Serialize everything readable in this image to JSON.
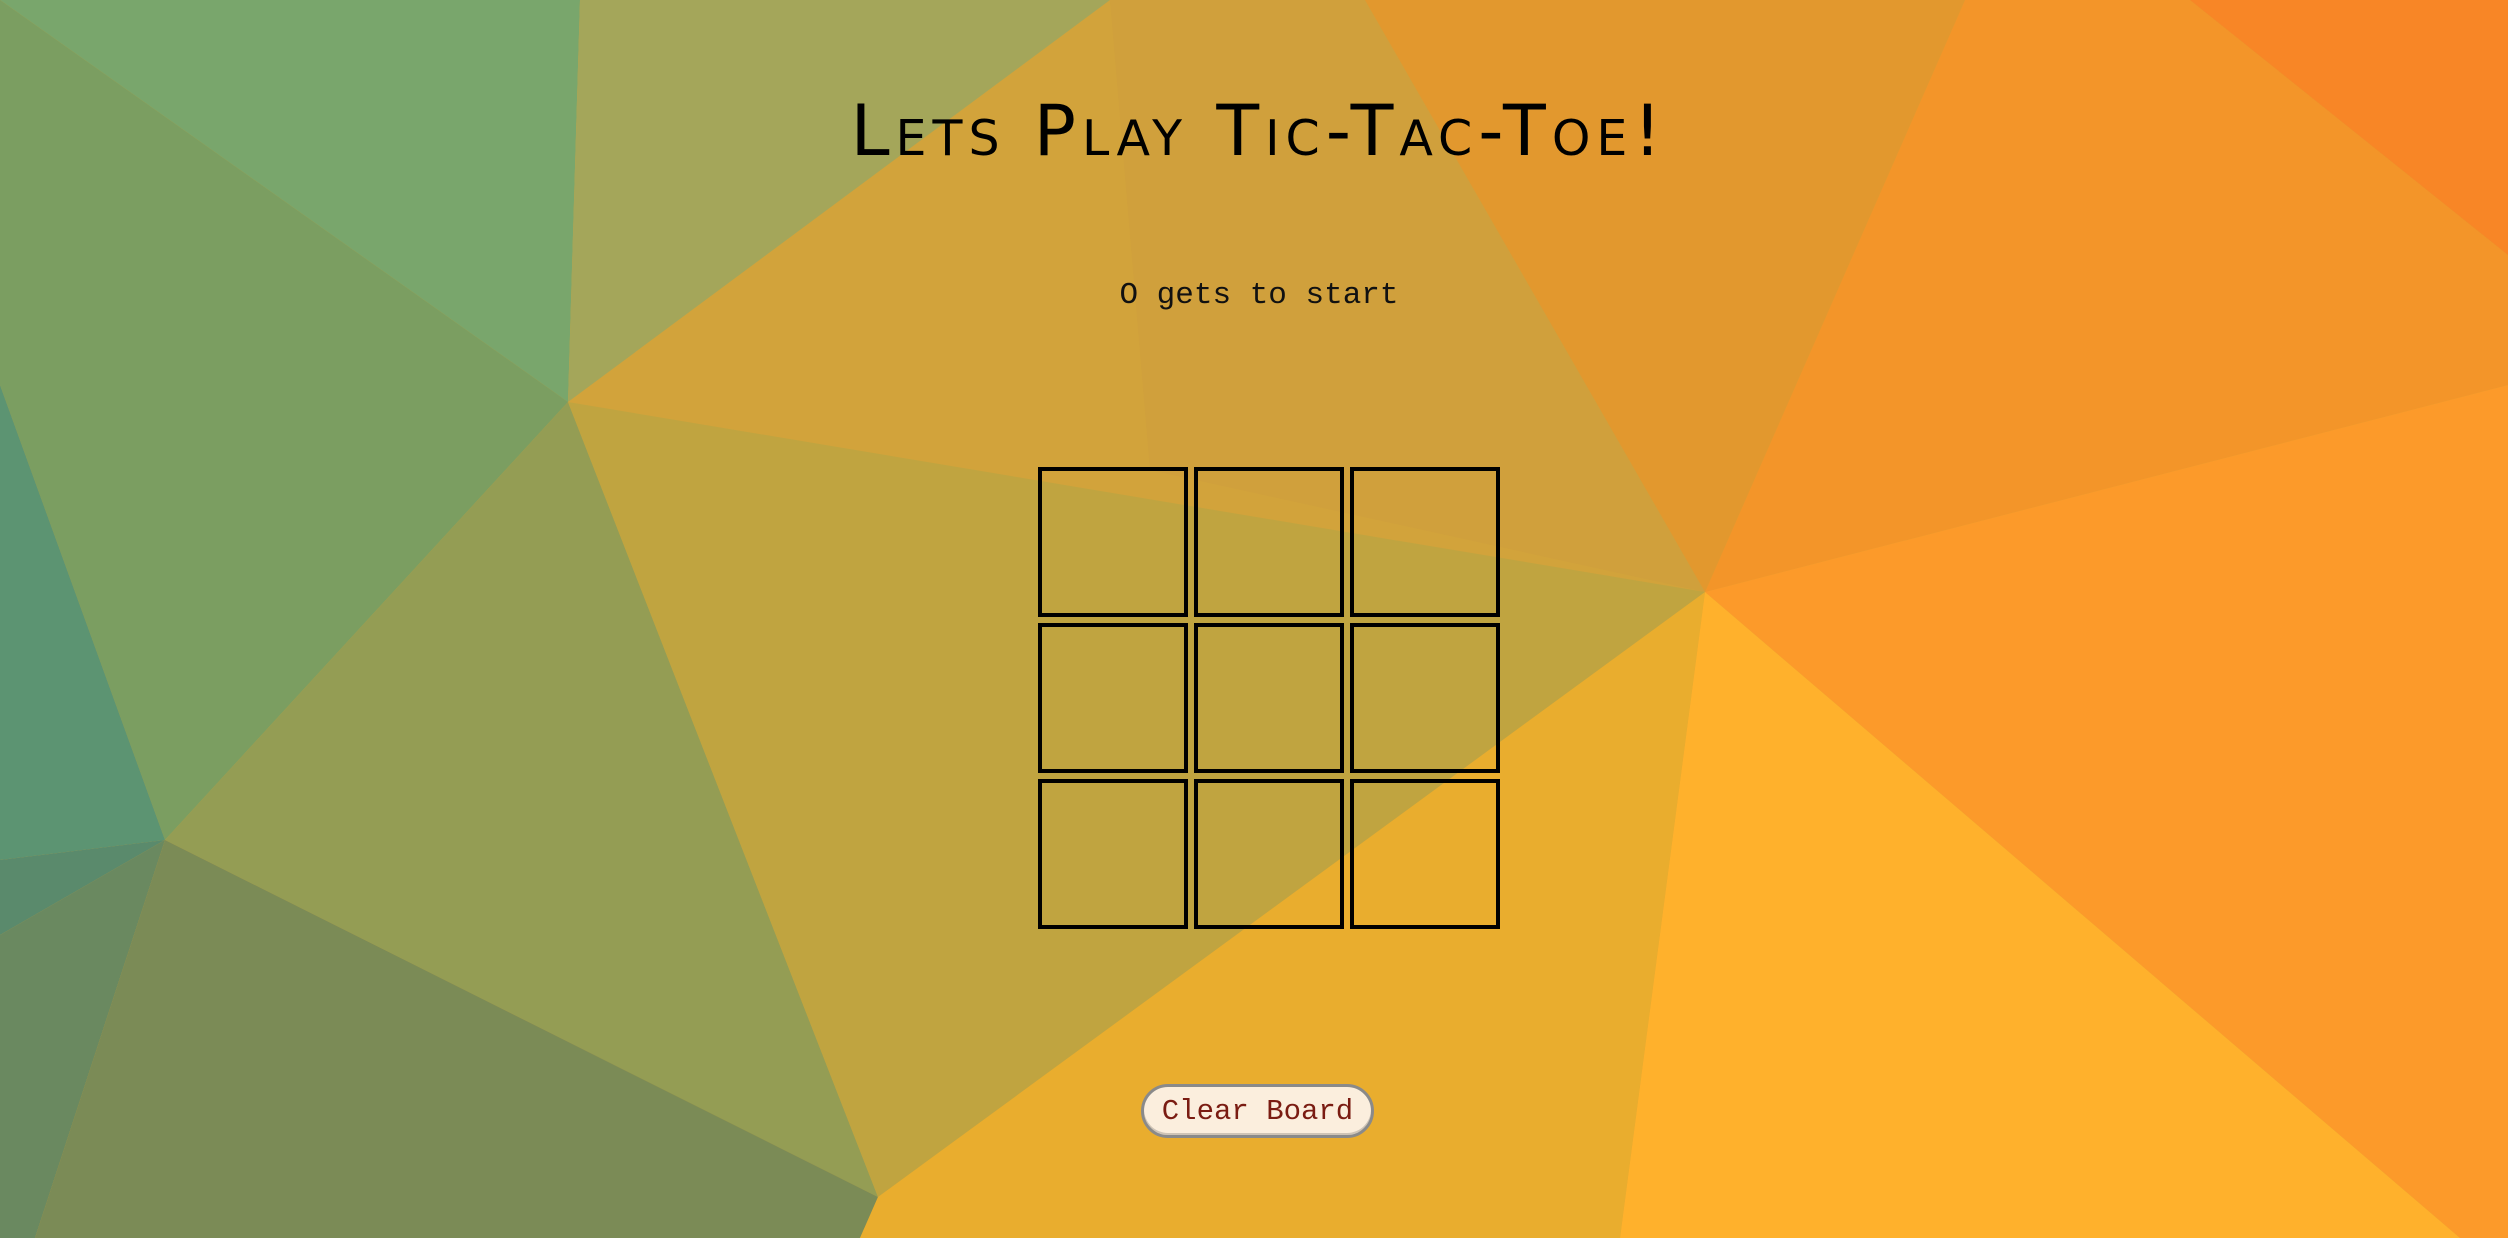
{
  "header": {
    "title": "Lets Play Tic-Tac-Toe!"
  },
  "status": {
    "text": "O gets to start"
  },
  "board": {
    "cells": [
      "",
      "",
      "",
      "",
      "",
      "",
      "",
      "",
      ""
    ]
  },
  "controls": {
    "clear_label": "Clear Board"
  },
  "colors": {
    "button_background": "#fbeedd",
    "button_text": "#7a1c12",
    "cell_border": "#000000",
    "title_text": "#000000"
  }
}
